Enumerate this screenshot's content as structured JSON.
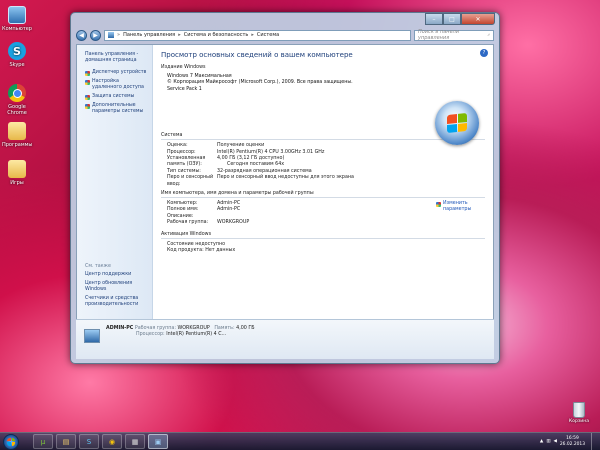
{
  "desktop": {
    "icons": [
      {
        "label": "Компьютер",
        "icon": "computer-icon"
      },
      {
        "label": "Skype",
        "icon": "skype-icon",
        "glyph": "S"
      },
      {
        "label": "Google Chrome",
        "icon": "chrome-icon"
      },
      {
        "label": "Программы",
        "icon": "folder-icon"
      },
      {
        "label": "Игры",
        "icon": "folder-icon"
      }
    ],
    "recycle_bin": "Корзина"
  },
  "window": {
    "breadcrumb": [
      "Панель управления",
      "Система и безопасность",
      "Система"
    ],
    "search_placeholder": "Поиск в панели управления",
    "left_pane": {
      "home_link": "Панель управления - домашняя страница",
      "tasks": [
        "Диспетчер устройств",
        "Настройка удаленного доступа",
        "Защита системы",
        "Дополнительные параметры системы"
      ],
      "see_also_header": "См. также",
      "see_also": [
        "Центр поддержки",
        "Центр обновления Windows",
        "Счетчики и средства производительности"
      ]
    },
    "main": {
      "title": "Просмотр основных сведений о вашем компьютере",
      "edition_section": "Издание Windows",
      "edition_lines": [
        "Windows 7 Максимальная",
        "© Корпорация Майкрософт (Microsoft Corp.), 2009. Все права защищены.",
        "Service Pack 1"
      ],
      "system_section": "Система",
      "system_rows": [
        {
          "label": "Оценка:",
          "value": "Получение оценки",
          "link": true
        },
        {
          "label": "Процессор:",
          "value": "Intel(R) Pentium(R) 4 CPU 3.00GHz   3.01 GHz"
        },
        {
          "label": "Установленная память (ОЗУ):",
          "value": "4,00 ГБ (3,12 ГБ доступно)"
        },
        {
          "label": "Тип системы:",
          "value": "32-разрядная операционная система"
        },
        {
          "label": "Перо и сенсорный ввод:",
          "value": "Перо и сенсорный ввод недоступны для этого экрана"
        }
      ],
      "system_extra": "Сегодня поставим 64х",
      "computer_section": "Имя компьютера, имя домена и параметры рабочей группы",
      "computer_rows": [
        {
          "label": "Компьютер:",
          "value": "Admin-PC"
        },
        {
          "label": "Полное имя:",
          "value": "Admin-PC"
        },
        {
          "label": "Описание:",
          "value": ""
        },
        {
          "label": "Рабочая группа:",
          "value": "WORKGROUP"
        }
      ],
      "change_link": "Изменить параметры",
      "activation_section": "Активация Windows",
      "activation_rows": [
        {
          "label": "Состояние недоступно",
          "value": ""
        },
        {
          "label": "Код продукта: Нет данных",
          "value": ""
        }
      ]
    },
    "details": {
      "name": "ADMIN-PC",
      "workgroup_label": "Рабочая группа:",
      "workgroup": "WORKGROUP",
      "memory_label": "Память:",
      "memory": "4,00 ГБ",
      "cpu_label": "Процессор:",
      "cpu": "Intel(R) Pentium(R) 4 C..."
    }
  },
  "taskbar": {
    "buttons": [
      {
        "name": "utorrent",
        "glyph": "µ"
      },
      {
        "name": "explorer",
        "glyph": "▤"
      },
      {
        "name": "skype",
        "glyph": "S"
      },
      {
        "name": "chrome",
        "glyph": "◉"
      },
      {
        "name": "media",
        "glyph": "▦"
      },
      {
        "name": "control-panel",
        "glyph": "▣"
      }
    ],
    "time": "16:59",
    "date": "26.02.2013"
  }
}
